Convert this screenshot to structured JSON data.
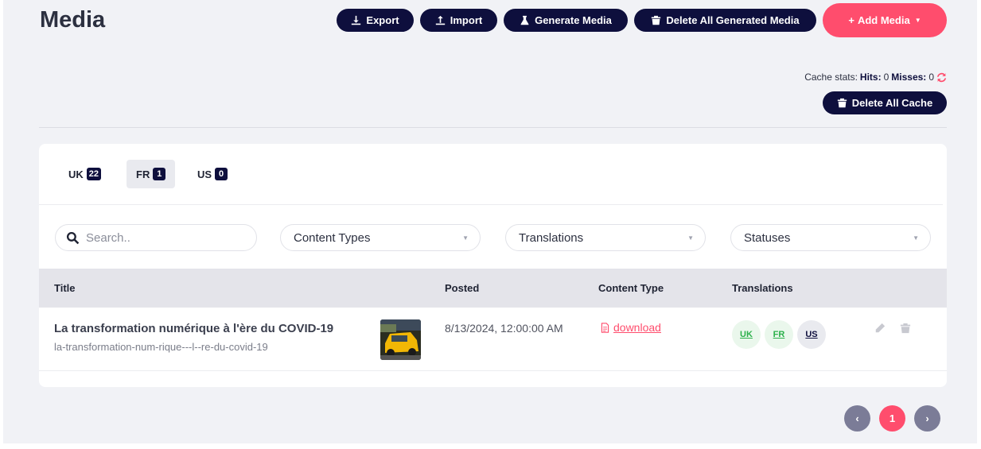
{
  "header": {
    "title": "Media",
    "buttons": {
      "export": "Export",
      "import": "Import",
      "generate": "Generate Media",
      "delete_generated": "Delete All Generated Media",
      "add": "Add Media"
    }
  },
  "cache": {
    "label": "Cache stats:",
    "hits_label": "Hits:",
    "hits": "0",
    "misses_label": "Misses:",
    "misses": "0",
    "delete_button": "Delete All Cache"
  },
  "tabs": [
    {
      "label": "UK",
      "count": "22"
    },
    {
      "label": "FR",
      "count": "1"
    },
    {
      "label": "US",
      "count": "0"
    }
  ],
  "filters": {
    "search_placeholder": "Search..",
    "content_types": "Content Types",
    "translations": "Translations",
    "statuses": "Statuses"
  },
  "table": {
    "columns": [
      "Title",
      "Posted",
      "Content Type",
      "Translations"
    ],
    "rows": [
      {
        "title": "La transformation numérique à l'ère du COVID-19",
        "slug": "la-transformation-num-rique---l--re-du-covid-19",
        "posted": "8/13/2024, 12:00:00 AM",
        "content_type": "download",
        "translations": [
          "UK",
          "FR",
          "US"
        ]
      }
    ]
  },
  "pagination": {
    "current": "1",
    "prev": "‹",
    "next": "›"
  },
  "colors": {
    "primary": "#0e0f3d",
    "accent": "#ff4d6d",
    "success": "#2bb04a"
  }
}
